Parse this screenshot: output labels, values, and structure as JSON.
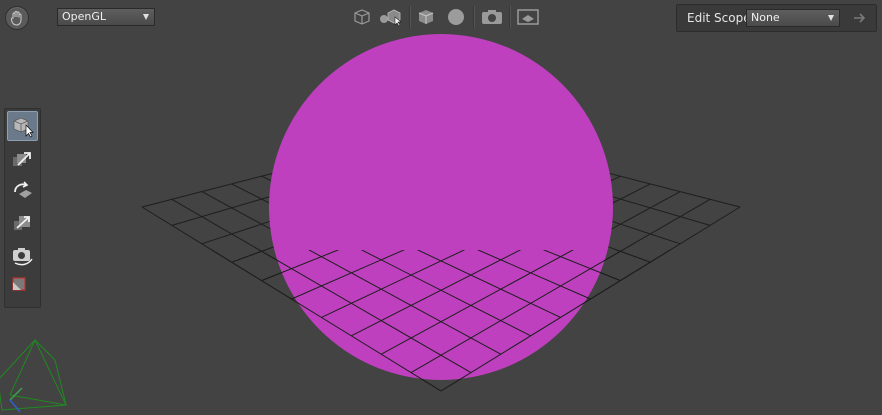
{
  "renderer": {
    "value": "OpenGL"
  },
  "toolbar": {
    "icons": [
      "wireframe-cube-icon",
      "shaded-objects-icon",
      "cube-icon",
      "sphere-icon",
      "camera-icon",
      "background-icon"
    ]
  },
  "edit_scope": {
    "label": "Edit Scope",
    "value": "None"
  },
  "tools": [
    {
      "name": "select-tool",
      "active": true
    },
    {
      "name": "translate-tool",
      "active": false
    },
    {
      "name": "rotate-tool",
      "active": false
    },
    {
      "name": "scale-tool",
      "active": false
    },
    {
      "name": "camera-tool",
      "active": false
    },
    {
      "name": "crop-window-tool",
      "active": false
    }
  ],
  "colors": {
    "background": "#434343",
    "sphere": "#be40be",
    "grid": "#1e1e1e",
    "camera_frustum": "#1f8a1f"
  }
}
